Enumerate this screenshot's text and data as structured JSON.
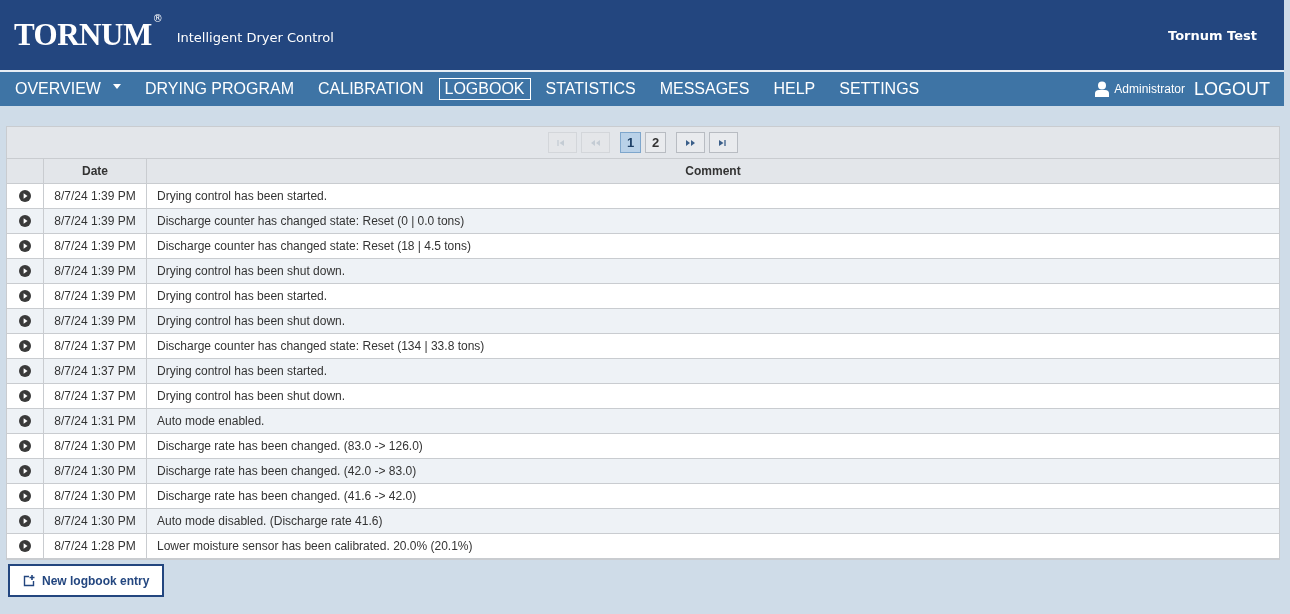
{
  "header": {
    "logo": "TORNUM",
    "logo_mark": "®",
    "subtitle": "Intelligent Dryer Control",
    "site": "Tornum Test"
  },
  "nav": {
    "items": [
      {
        "label": "OVERVIEW",
        "selected": false,
        "dropdown": true
      },
      {
        "label": "DRYING PROGRAM",
        "selected": false,
        "dropdown": false
      },
      {
        "label": "CALIBRATION",
        "selected": false,
        "dropdown": false
      },
      {
        "label": "LOGBOOK",
        "selected": true,
        "dropdown": false
      },
      {
        "label": "STATISTICS",
        "selected": false,
        "dropdown": false
      },
      {
        "label": "MESSAGES",
        "selected": false,
        "dropdown": false
      },
      {
        "label": "HELP",
        "selected": false,
        "dropdown": false
      },
      {
        "label": "SETTINGS",
        "selected": false,
        "dropdown": false
      }
    ],
    "user": "Administrator",
    "logout": "LOGOUT"
  },
  "pager": {
    "first": {
      "disabled": true
    },
    "prev": {
      "disabled": true
    },
    "pages": [
      {
        "label": "1",
        "selected": true
      },
      {
        "label": "2",
        "selected": false
      }
    ],
    "next": {
      "disabled": false
    },
    "last": {
      "disabled": false
    }
  },
  "table": {
    "columns": [
      "Date",
      "Comment"
    ],
    "rows": [
      {
        "date": "8/7/24 1:39 PM",
        "comment": "Drying control has been started."
      },
      {
        "date": "8/7/24 1:39 PM",
        "comment": "Discharge counter has changed state: Reset (0 | 0.0 tons)"
      },
      {
        "date": "8/7/24 1:39 PM",
        "comment": "Discharge counter has changed state: Reset (18 | 4.5 tons)"
      },
      {
        "date": "8/7/24 1:39 PM",
        "comment": "Drying control has been shut down."
      },
      {
        "date": "8/7/24 1:39 PM",
        "comment": "Drying control has been started."
      },
      {
        "date": "8/7/24 1:39 PM",
        "comment": "Drying control has been shut down."
      },
      {
        "date": "8/7/24 1:37 PM",
        "comment": "Discharge counter has changed state: Reset (134 | 33.8 tons)"
      },
      {
        "date": "8/7/24 1:37 PM",
        "comment": "Drying control has been started."
      },
      {
        "date": "8/7/24 1:37 PM",
        "comment": "Drying control has been shut down."
      },
      {
        "date": "8/7/24 1:31 PM",
        "comment": "Auto mode enabled."
      },
      {
        "date": "8/7/24 1:30 PM",
        "comment": "Discharge rate has been changed. (83.0 -> 126.0)"
      },
      {
        "date": "8/7/24 1:30 PM",
        "comment": "Discharge rate has been changed. (42.0 -> 83.0)"
      },
      {
        "date": "8/7/24 1:30 PM",
        "comment": "Discharge rate has been changed. (41.6 -> 42.0)"
      },
      {
        "date": "8/7/24 1:30 PM",
        "comment": "Auto mode disabled. (Discharge rate 41.6)"
      },
      {
        "date": "8/7/24 1:28 PM",
        "comment": "Lower moisture sensor has been calibrated. 20.0% (20.1%)"
      }
    ]
  },
  "new_entry_button": "New logbook entry"
}
